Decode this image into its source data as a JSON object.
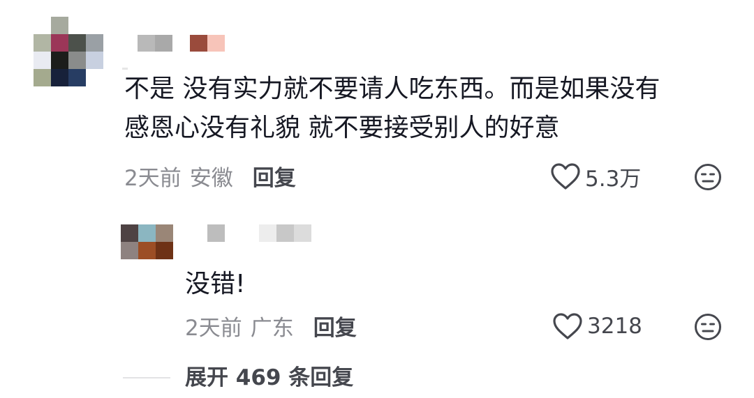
{
  "comment": {
    "text_line1": "不是 没有实力就不要请人吃东西。而是如果没有",
    "text_line2": "感恩心没有礼貌 就不要接受别人的好意",
    "time": "2天前",
    "location": "安徽",
    "reply_label": "回复",
    "likes": "5.3万",
    "avatar_icon": "pixelated-avatar",
    "username_icon": "pixelated-username",
    "like_icon": "heart-outline-icon",
    "dislike_icon": "meh-face-icon"
  },
  "reply": {
    "text": "没错!",
    "time": "2天前",
    "location": "广东",
    "reply_label": "回复",
    "likes": "3218"
  },
  "expand": {
    "label": "展开 469 条回复"
  },
  "colors": {
    "text_primary": "#161823",
    "text_meta": "#8a8b91",
    "text_action": "#45474e",
    "background": "#ffffff"
  }
}
